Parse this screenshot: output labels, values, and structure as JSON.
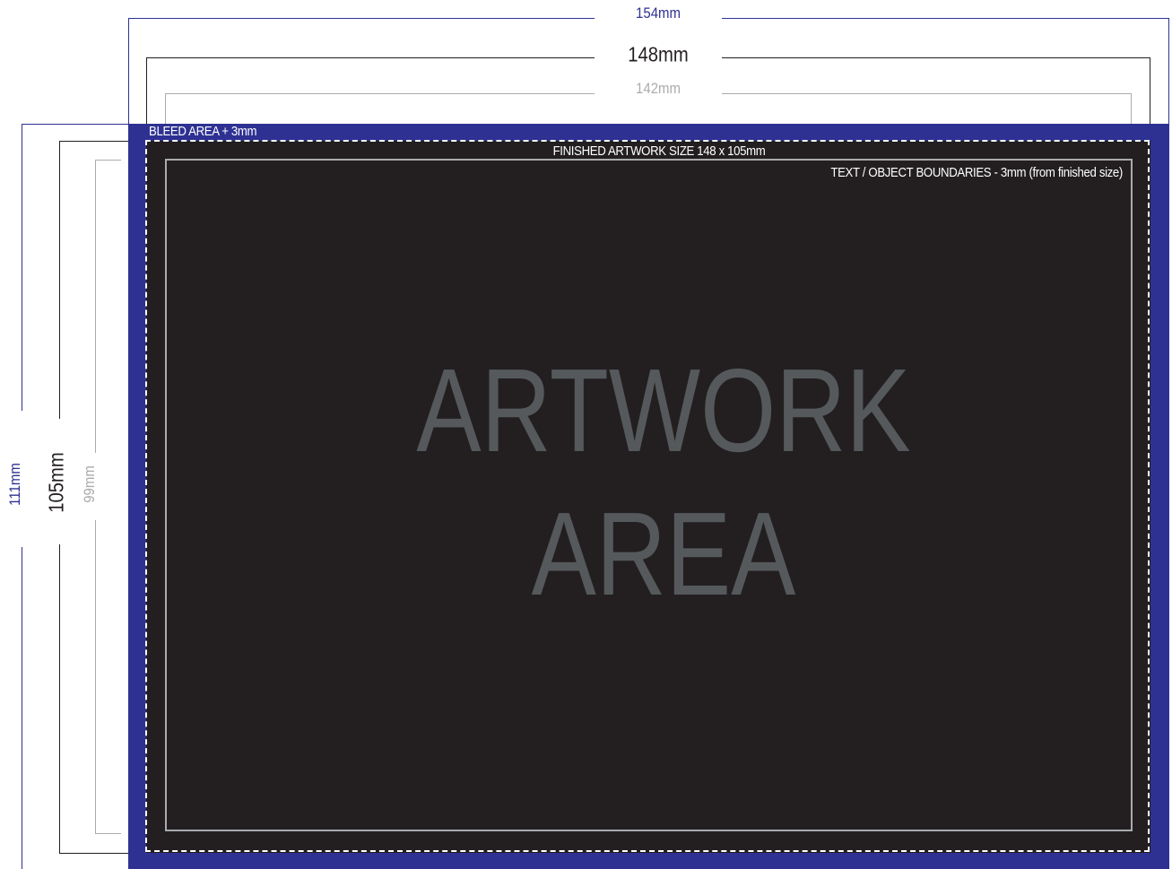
{
  "dimensions": {
    "width_outer": "154mm",
    "width_finished": "148mm",
    "width_safe": "142mm",
    "height_outer": "111mm",
    "height_finished": "105mm",
    "height_safe": "99mm"
  },
  "labels": {
    "bleed": "BLEED AREA + 3mm",
    "finished": "FINISHED ARTWORK SIZE 148 x 105mm",
    "text_boundary": "TEXT / OBJECT BOUNDARIES - 3mm (from finished size)"
  },
  "artwork": {
    "line1": "ARTWORK",
    "line2": "AREA"
  },
  "colors": {
    "bleed": "#2e3192",
    "artwork": "#231f20",
    "text_boundary": "#a9abae",
    "artwork_text": "#55595b",
    "dimension_finished": "#231f20",
    "dimension_safe": "#a9abae"
  }
}
